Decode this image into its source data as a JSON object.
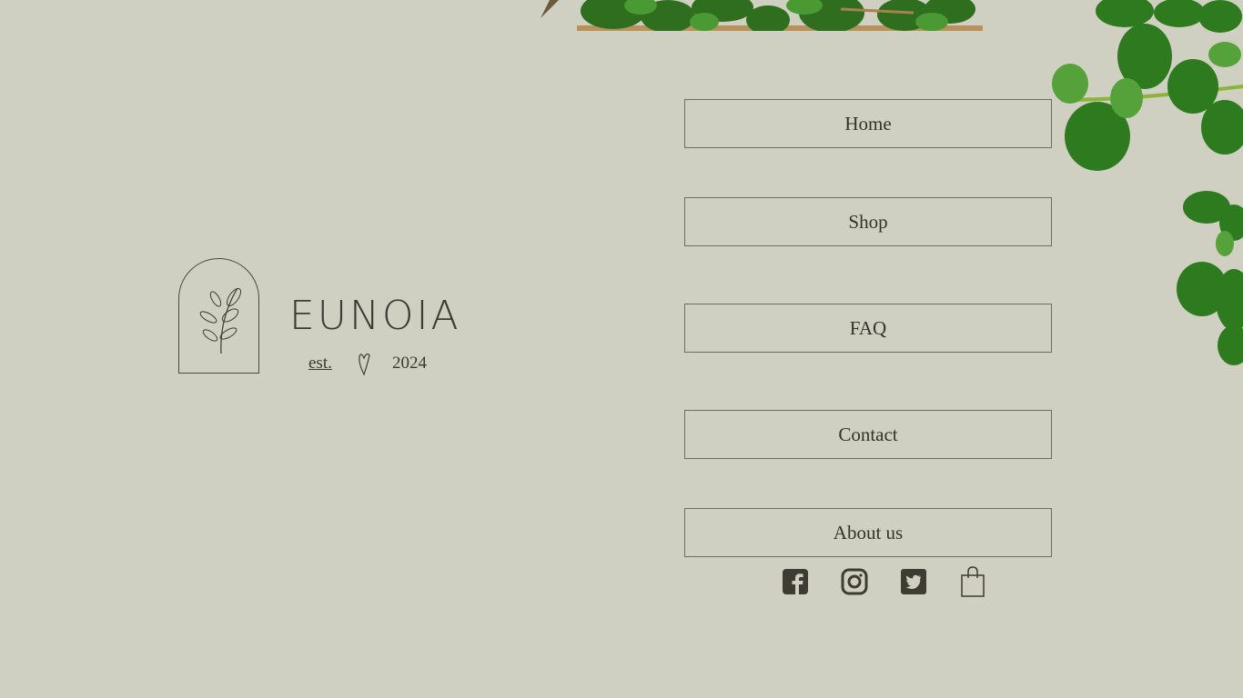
{
  "brand": {
    "name": "EUNOIA",
    "est_label": "est.",
    "year": "2024"
  },
  "nav": {
    "items": [
      {
        "label": "Home"
      },
      {
        "label": "Shop"
      },
      {
        "label": "FAQ"
      },
      {
        "label": "Contact"
      },
      {
        "label": "About us"
      }
    ]
  },
  "social": {
    "icons": [
      "facebook-icon",
      "instagram-icon",
      "twitter-icon",
      "shopping-bag-icon"
    ]
  },
  "colors": {
    "background": "#cfd0c2",
    "text": "#3a382f",
    "leaf": "#2f7a22"
  }
}
